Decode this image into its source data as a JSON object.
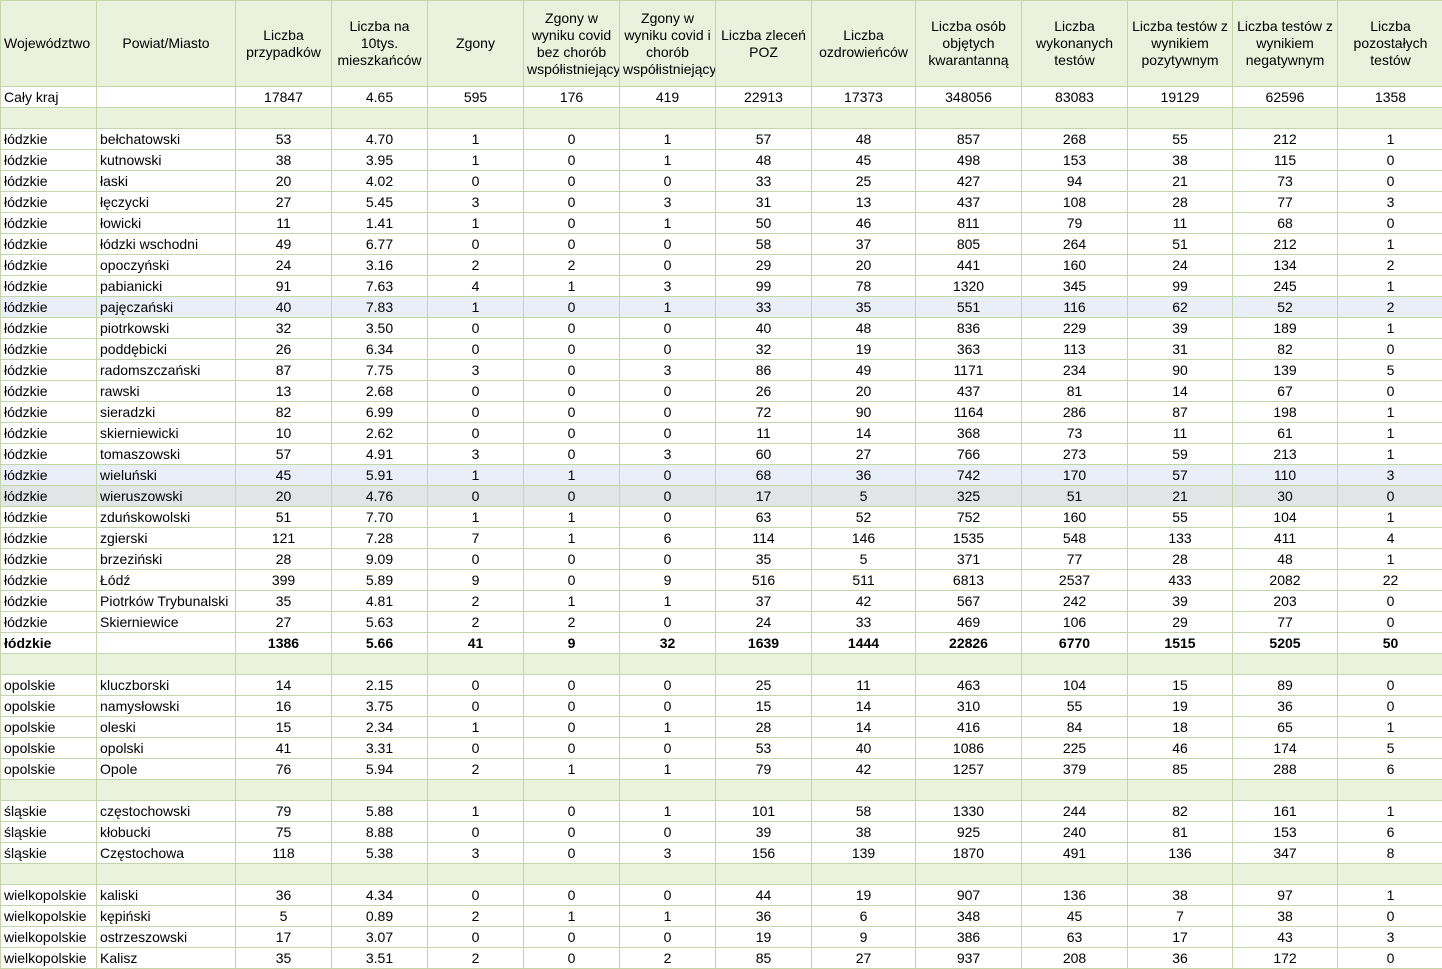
{
  "headers": [
    "Województwo",
    "Powiat/Miasto",
    "Liczba przypadków",
    "Liczba na 10tys. mieszkańców",
    "Zgony",
    "Zgony w wyniku covid bez chorób współistniejących",
    "Zgony w wyniku covid i chorób współistniejących",
    "Liczba zleceń POZ",
    "Liczba ozdrowieńców",
    "Liczba osób objętych kwarantanną",
    "Liczba wykonanych testów",
    "Liczba testów z wynikiem pozytywnym",
    "Liczba testów z wynikiem negatywnym",
    "Liczba pozostałych testów"
  ],
  "rows": [
    {
      "type": "data",
      "cells": [
        "Cały kraj",
        "",
        "17847",
        "4.65",
        "595",
        "176",
        "419",
        "22913",
        "17373",
        "348056",
        "83083",
        "19129",
        "62596",
        "1358"
      ]
    },
    {
      "type": "spacer"
    },
    {
      "type": "data",
      "cells": [
        "łódzkie",
        "bełchatowski",
        "53",
        "4.70",
        "1",
        "0",
        "1",
        "57",
        "48",
        "857",
        "268",
        "55",
        "212",
        "1"
      ]
    },
    {
      "type": "data",
      "cells": [
        "łódzkie",
        "kutnowski",
        "38",
        "3.95",
        "1",
        "0",
        "1",
        "48",
        "45",
        "498",
        "153",
        "38",
        "115",
        "0"
      ]
    },
    {
      "type": "data",
      "cells": [
        "łódzkie",
        "łaski",
        "20",
        "4.02",
        "0",
        "0",
        "0",
        "33",
        "25",
        "427",
        "94",
        "21",
        "73",
        "0"
      ]
    },
    {
      "type": "data",
      "cells": [
        "łódzkie",
        "łęczycki",
        "27",
        "5.45",
        "3",
        "0",
        "3",
        "31",
        "13",
        "437",
        "108",
        "28",
        "77",
        "3"
      ]
    },
    {
      "type": "data",
      "cells": [
        "łódzkie",
        "łowicki",
        "11",
        "1.41",
        "1",
        "0",
        "1",
        "50",
        "46",
        "811",
        "79",
        "11",
        "68",
        "0"
      ]
    },
    {
      "type": "data",
      "cells": [
        "łódzkie",
        "łódzki wschodni",
        "49",
        "6.77",
        "0",
        "0",
        "0",
        "58",
        "37",
        "805",
        "264",
        "51",
        "212",
        "1"
      ]
    },
    {
      "type": "data",
      "cells": [
        "łódzkie",
        "opoczyński",
        "24",
        "3.16",
        "2",
        "2",
        "0",
        "29",
        "20",
        "441",
        "160",
        "24",
        "134",
        "2"
      ]
    },
    {
      "type": "data",
      "cells": [
        "łódzkie",
        "pabianicki",
        "91",
        "7.63",
        "4",
        "1",
        "3",
        "99",
        "78",
        "1320",
        "345",
        "99",
        "245",
        "1"
      ]
    },
    {
      "type": "data",
      "hl": "blue",
      "cells": [
        "łódzkie",
        "pajęczański",
        "40",
        "7.83",
        "1",
        "0",
        "1",
        "33",
        "35",
        "551",
        "116",
        "62",
        "52",
        "2"
      ]
    },
    {
      "type": "data",
      "cells": [
        "łódzkie",
        "piotrkowski",
        "32",
        "3.50",
        "0",
        "0",
        "0",
        "40",
        "48",
        "836",
        "229",
        "39",
        "189",
        "1"
      ]
    },
    {
      "type": "data",
      "cells": [
        "łódzkie",
        "poddębicki",
        "26",
        "6.34",
        "0",
        "0",
        "0",
        "32",
        "19",
        "363",
        "113",
        "31",
        "82",
        "0"
      ]
    },
    {
      "type": "data",
      "cells": [
        "łódzkie",
        "radomszczański",
        "87",
        "7.75",
        "3",
        "0",
        "3",
        "86",
        "49",
        "1171",
        "234",
        "90",
        "139",
        "5"
      ]
    },
    {
      "type": "data",
      "cells": [
        "łódzkie",
        "rawski",
        "13",
        "2.68",
        "0",
        "0",
        "0",
        "26",
        "20",
        "437",
        "81",
        "14",
        "67",
        "0"
      ]
    },
    {
      "type": "data",
      "cells": [
        "łódzkie",
        "sieradzki",
        "82",
        "6.99",
        "0",
        "0",
        "0",
        "72",
        "90",
        "1164",
        "286",
        "87",
        "198",
        "1"
      ]
    },
    {
      "type": "data",
      "cells": [
        "łódzkie",
        "skierniewicki",
        "10",
        "2.62",
        "0",
        "0",
        "0",
        "11",
        "14",
        "368",
        "73",
        "11",
        "61",
        "1"
      ]
    },
    {
      "type": "data",
      "cells": [
        "łódzkie",
        "tomaszowski",
        "57",
        "4.91",
        "3",
        "0",
        "3",
        "60",
        "27",
        "766",
        "273",
        "59",
        "213",
        "1"
      ]
    },
    {
      "type": "data",
      "hl": "blue",
      "cells": [
        "łódzkie",
        "wieluński",
        "45",
        "5.91",
        "1",
        "1",
        "0",
        "68",
        "36",
        "742",
        "170",
        "57",
        "110",
        "3"
      ]
    },
    {
      "type": "data",
      "hl": "gray",
      "cells": [
        "łódzkie",
        "wieruszowski",
        "20",
        "4.76",
        "0",
        "0",
        "0",
        "17",
        "5",
        "325",
        "51",
        "21",
        "30",
        "0"
      ]
    },
    {
      "type": "data",
      "cells": [
        "łódzkie",
        "zduńskowolski",
        "51",
        "7.70",
        "1",
        "1",
        "0",
        "63",
        "52",
        "752",
        "160",
        "55",
        "104",
        "1"
      ]
    },
    {
      "type": "data",
      "cells": [
        "łódzkie",
        "zgierski",
        "121",
        "7.28",
        "7",
        "1",
        "6",
        "114",
        "146",
        "1535",
        "548",
        "133",
        "411",
        "4"
      ]
    },
    {
      "type": "data",
      "cells": [
        "łódzkie",
        "brzeziński",
        "28",
        "9.09",
        "0",
        "0",
        "0",
        "35",
        "5",
        "371",
        "77",
        "28",
        "48",
        "1"
      ]
    },
    {
      "type": "data",
      "cells": [
        "łódzkie",
        "Łódź",
        "399",
        "5.89",
        "9",
        "0",
        "9",
        "516",
        "511",
        "6813",
        "2537",
        "433",
        "2082",
        "22"
      ]
    },
    {
      "type": "data",
      "cells": [
        "łódzkie",
        "Piotrków Trybunalski",
        "35",
        "4.81",
        "2",
        "1",
        "1",
        "37",
        "42",
        "567",
        "242",
        "39",
        "203",
        "0"
      ]
    },
    {
      "type": "data",
      "cells": [
        "łódzkie",
        "Skierniewice",
        "27",
        "5.63",
        "2",
        "2",
        "0",
        "24",
        "33",
        "469",
        "106",
        "29",
        "77",
        "0"
      ]
    },
    {
      "type": "data",
      "bold": true,
      "cells": [
        "łódzkie",
        "",
        "1386",
        "5.66",
        "41",
        "9",
        "32",
        "1639",
        "1444",
        "22826",
        "6770",
        "1515",
        "5205",
        "50"
      ]
    },
    {
      "type": "spacer"
    },
    {
      "type": "data",
      "cells": [
        "opolskie",
        "kluczborski",
        "14",
        "2.15",
        "0",
        "0",
        "0",
        "25",
        "11",
        "463",
        "104",
        "15",
        "89",
        "0"
      ]
    },
    {
      "type": "data",
      "cells": [
        "opolskie",
        "namysłowski",
        "16",
        "3.75",
        "0",
        "0",
        "0",
        "15",
        "14",
        "310",
        "55",
        "19",
        "36",
        "0"
      ]
    },
    {
      "type": "data",
      "cells": [
        "opolskie",
        "oleski",
        "15",
        "2.34",
        "1",
        "0",
        "1",
        "28",
        "14",
        "416",
        "84",
        "18",
        "65",
        "1"
      ]
    },
    {
      "type": "data",
      "cells": [
        "opolskie",
        "opolski",
        "41",
        "3.31",
        "0",
        "0",
        "0",
        "53",
        "40",
        "1086",
        "225",
        "46",
        "174",
        "5"
      ]
    },
    {
      "type": "data",
      "cells": [
        "opolskie",
        "Opole",
        "76",
        "5.94",
        "2",
        "1",
        "1",
        "79",
        "42",
        "1257",
        "379",
        "85",
        "288",
        "6"
      ]
    },
    {
      "type": "spacer"
    },
    {
      "type": "data",
      "cells": [
        "śląskie",
        "częstochowski",
        "79",
        "5.88",
        "1",
        "0",
        "1",
        "101",
        "58",
        "1330",
        "244",
        "82",
        "161",
        "1"
      ]
    },
    {
      "type": "data",
      "cells": [
        "śląskie",
        "kłobucki",
        "75",
        "8.88",
        "0",
        "0",
        "0",
        "39",
        "38",
        "925",
        "240",
        "81",
        "153",
        "6"
      ]
    },
    {
      "type": "data",
      "cells": [
        "śląskie",
        "Częstochowa",
        "118",
        "5.38",
        "3",
        "0",
        "3",
        "156",
        "139",
        "1870",
        "491",
        "136",
        "347",
        "8"
      ]
    },
    {
      "type": "spacer"
    },
    {
      "type": "data",
      "cells": [
        "wielkopolskie",
        "kaliski",
        "36",
        "4.34",
        "0",
        "0",
        "0",
        "44",
        "19",
        "907",
        "136",
        "38",
        "97",
        "1"
      ]
    },
    {
      "type": "data",
      "cells": [
        "wielkopolskie",
        "kępiński",
        "5",
        "0.89",
        "2",
        "1",
        "1",
        "36",
        "6",
        "348",
        "45",
        "7",
        "38",
        "0"
      ]
    },
    {
      "type": "data",
      "cells": [
        "wielkopolskie",
        "ostrzeszowski",
        "17",
        "3.07",
        "0",
        "0",
        "0",
        "19",
        "9",
        "386",
        "63",
        "17",
        "43",
        "3"
      ]
    },
    {
      "type": "data",
      "cells": [
        "wielkopolskie",
        "Kalisz",
        "35",
        "3.51",
        "2",
        "0",
        "2",
        "85",
        "27",
        "937",
        "208",
        "36",
        "172",
        "0"
      ]
    }
  ]
}
